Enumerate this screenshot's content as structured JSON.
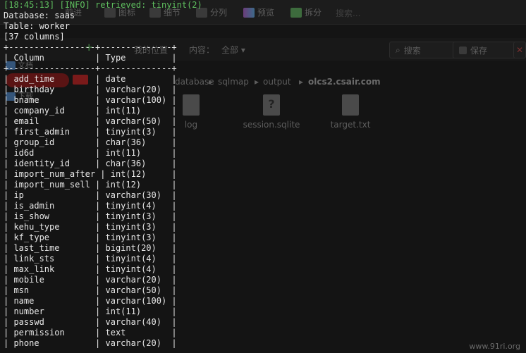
{
  "background_app": {
    "toolbar": {
      "items": [
        "前进",
        "图标",
        "细节",
        "分列",
        "预览",
        "拆分"
      ],
      "search_placeholder": "搜索..."
    },
    "location_bar": {
      "position_label": "我的位置",
      "content_label": "内容：",
      "content_value": "全部",
      "search_button": "搜索",
      "save_button": "保存"
    },
    "sidebar": [
      "桌面",
      "文档",
      "下载"
    ],
    "breadcrumb": [
      "database",
      "sqlmap",
      "output",
      "olcs2.csair.com"
    ],
    "files": [
      {
        "name": "log",
        "icon": "document-icon"
      },
      {
        "name": "session.sqlite",
        "icon": "unknown-file-icon"
      },
      {
        "name": "target.txt",
        "icon": "document-icon"
      }
    ],
    "watermark": "www.91ri.org"
  },
  "terminal": {
    "info_line": "[18:45:13] [INFO] retrieved: tinyint(2)",
    "database_line": "Database: saas",
    "table_line": "Table: worker",
    "columns_count": "[37 columns]",
    "border": "+-----------------+--------------+",
    "header": "| Column          | Type         |",
    "rows": [
      "| add_time        | date         |",
      "| birthday        | varchar(20)  |",
      "| bname           | varchar(100) |",
      "| company_id      | int(11)      |",
      "| email           | varchar(50)  |",
      "| first_admin     | tinyint(3)   |",
      "| group_id        | char(36)     |",
      "| id6d            | int(11)      |",
      "| identity_id     | char(36)     |",
      "| import_num_after | int(12)     |",
      "| import_num_sell | int(12)      |",
      "| ip              | varchar(30)  |",
      "| is_admin        | tinyint(4)   |",
      "| is_show         | tinyint(3)   |",
      "| kehu_type       | tinyint(3)   |",
      "| kf_type         | tinyint(3)   |",
      "| last_time       | bigint(20)   |",
      "| link_sts        | tinyint(4)   |",
      "| max_link        | tinyint(4)   |",
      "| mobile          | varchar(20)  |",
      "| msn             | varchar(50)  |",
      "| name            | varchar(100) |",
      "| number          | int(11)      |",
      "| passwd          | varchar(40)  |",
      "| permission      | text         |",
      "| phone           | varchar(20)  |"
    ]
  }
}
